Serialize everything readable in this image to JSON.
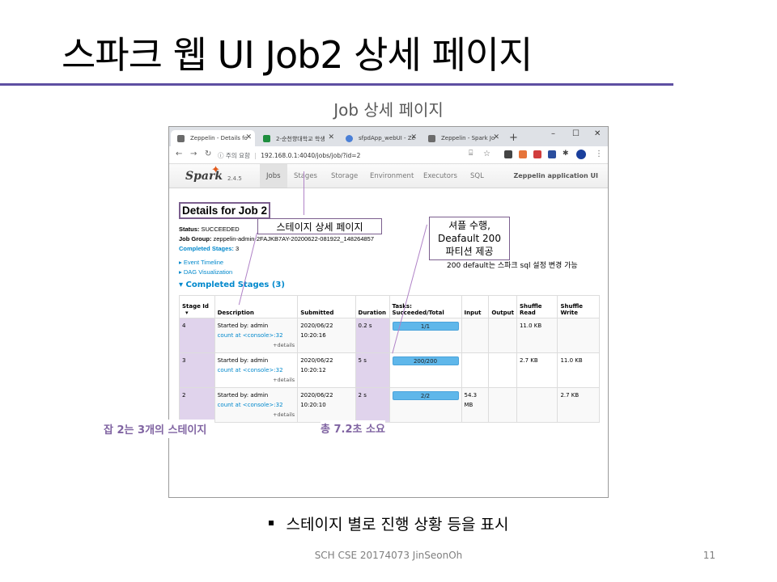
{
  "slide": {
    "title": "스파크 웹 UI Job2 상세 페이지",
    "subtitle": "Job 상세 페이지",
    "bullet": "스테이지 별로 진행 상황 등을 표시",
    "footer": "SCH CSE 20174073 JinSeonOh",
    "page_number": "11",
    "accent_color": "#5e4fa2"
  },
  "browser": {
    "tabs": [
      {
        "label": "Zeppelin - Details fo",
        "icon": "zeppelin-favicon"
      },
      {
        "label": "2-순천향대학교 학생",
        "icon": "sheet-favicon"
      },
      {
        "label": "sfpdApp_webUI - Ze",
        "icon": "feather-favicon"
      },
      {
        "label": "Zeppelin - Spark Jo",
        "icon": "zeppelin-favicon"
      }
    ],
    "new_tab": "+",
    "window_controls": [
      "–",
      "☐",
      "✕"
    ],
    "security_label": "주의 요함",
    "url": "192.168.0.1:4040/jobs/job/?id=2"
  },
  "spark_nav": {
    "logo": "Spark",
    "version": "2.4.5",
    "items": [
      "Jobs",
      "Stages",
      "Storage",
      "Environment",
      "Executors",
      "SQL"
    ],
    "active": "Jobs",
    "app_name": "Zeppelin application UI"
  },
  "job": {
    "heading": "Details for Job 2",
    "status_label": "Status:",
    "status": "SUCCEEDED",
    "group_label": "Job Group:",
    "group": "zeppelin-admin-2FAJKB7AY-20200622-081922_148264857",
    "completed_label": "Completed Stages:",
    "completed": "3",
    "event_timeline": "Event Timeline",
    "dag_visualization": "DAG Visualization",
    "section": "Completed Stages (3)"
  },
  "table": {
    "headers": [
      "Stage Id",
      "Description",
      "Submitted",
      "Duration",
      "Tasks: Succeeded/Total",
      "Input",
      "Output",
      "Shuffle Read",
      "Shuffle Write"
    ],
    "sort_marker": "▾",
    "rows": [
      {
        "id": "4",
        "started_by": "Started by: admin",
        "link": "count at <console>:32",
        "details": "+details",
        "submitted": "2020/06/22 10:20:16",
        "duration": "0.2 s",
        "tasks": "1/1",
        "progress": 1.0,
        "input": "",
        "output": "",
        "shuffle_read": "11.0 KB",
        "shuffle_write": ""
      },
      {
        "id": "3",
        "started_by": "Started by: admin",
        "link": "count at <console>:32",
        "details": "+details",
        "submitted": "2020/06/22 10:20:12",
        "duration": "5 s",
        "tasks": "200/200",
        "progress": 1.0,
        "input": "",
        "output": "",
        "shuffle_read": "2.7 KB",
        "shuffle_write": "11.0 KB"
      },
      {
        "id": "2",
        "started_by": "Started by: admin",
        "link": "count at <console>:32",
        "details": "+details",
        "submitted": "2020/06/22 10:20:10",
        "duration": "2 s",
        "tasks": "2/2",
        "progress": 1.0,
        "input": "54.3 MB",
        "output": "",
        "shuffle_read": "",
        "shuffle_write": "2.7 KB"
      }
    ]
  },
  "annotations": {
    "stage_detail": "스테이지 상세 페이지",
    "shuffle_line1": "셔플 수행,",
    "shuffle_line2": "Deafault 200",
    "shuffle_line3": "파티션 제공",
    "small_note": "200 default는 스파크 sql 설정 변경 가능",
    "stage_count": "잡 2는 3개의 스테이지",
    "total_time": "총 7.2초 소요"
  }
}
